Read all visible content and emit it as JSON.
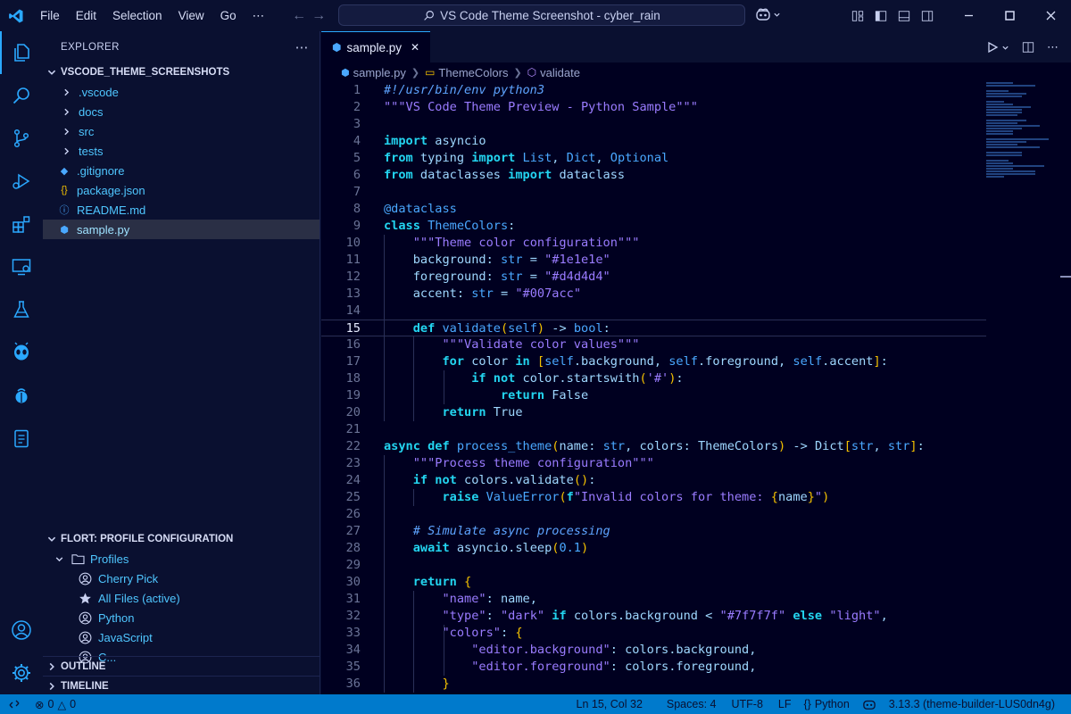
{
  "window": {
    "menu": [
      "File",
      "Edit",
      "Selection",
      "View",
      "Go",
      "⋯"
    ],
    "search_text": "VS Code Theme Screenshot - cyber_rain"
  },
  "sidebar": {
    "title": "EXPLORER",
    "more": "⋯",
    "workspace": "VSCODE_THEME_SCREENSHOTS",
    "items": [
      {
        "label": ".vscode",
        "kind": "folder"
      },
      {
        "label": "docs",
        "kind": "folder"
      },
      {
        "label": "src",
        "kind": "folder"
      },
      {
        "label": "tests",
        "kind": "folder"
      },
      {
        "label": ".gitignore",
        "kind": "file",
        "icon": "◆"
      },
      {
        "label": "package.json",
        "kind": "file",
        "icon": "{}"
      },
      {
        "label": "README.md",
        "kind": "file",
        "icon": "ⓘ"
      },
      {
        "label": "sample.py",
        "kind": "file",
        "icon": "⬢"
      }
    ],
    "profile_section": "FLORT: PROFILE CONFIGURATION",
    "profiles_label": "Profiles",
    "profiles": [
      "Cherry Pick",
      "All Files (active)",
      "Python",
      "JavaScript",
      "C..."
    ],
    "outline": "OUTLINE",
    "timeline": "TIMELINE"
  },
  "editor": {
    "tab": "sample.py",
    "close": "✕",
    "breadcrumb": [
      "sample.py",
      "ThemeColors",
      "validate"
    ],
    "current_line": 15,
    "lines": [
      [
        [
          "cm",
          "#!/usr/bin/env python3"
        ]
      ],
      [
        [
          "st",
          "\"\"\"VS Code Theme Preview - Python Sample\"\"\""
        ]
      ],
      [],
      [
        [
          "kw",
          "import"
        ],
        [
          "id",
          " asyncio"
        ]
      ],
      [
        [
          "kw",
          "from"
        ],
        [
          "id",
          " typing "
        ],
        [
          "kw",
          "import"
        ],
        [
          "ty",
          " List"
        ],
        [
          "op",
          ", "
        ],
        [
          "ty",
          "Dict"
        ],
        [
          "op",
          ", "
        ],
        [
          "ty",
          "Optional"
        ]
      ],
      [
        [
          "kw",
          "from"
        ],
        [
          "id",
          " dataclasses "
        ],
        [
          "kw",
          "import"
        ],
        [
          "id",
          " dataclass"
        ]
      ],
      [],
      [
        [
          "fn",
          "@dataclass"
        ]
      ],
      [
        [
          "kw",
          "class"
        ],
        [
          "ty",
          " ThemeColors"
        ],
        [
          "op",
          ":"
        ]
      ],
      [
        [
          "op",
          "    "
        ],
        [
          "st",
          "\"\"\"Theme color configuration\"\"\""
        ]
      ],
      [
        [
          "id",
          "    background"
        ],
        [
          "op",
          ": "
        ],
        [
          "ty",
          "str"
        ],
        [
          "op",
          " = "
        ],
        [
          "st",
          "\"#1e1e1e\""
        ]
      ],
      [
        [
          "id",
          "    foreground"
        ],
        [
          "op",
          ": "
        ],
        [
          "ty",
          "str"
        ],
        [
          "op",
          " = "
        ],
        [
          "st",
          "\"#d4d4d4\""
        ]
      ],
      [
        [
          "id",
          "    accent"
        ],
        [
          "op",
          ": "
        ],
        [
          "ty",
          "str"
        ],
        [
          "op",
          " = "
        ],
        [
          "st",
          "\"#007acc\""
        ]
      ],
      [],
      [
        [
          "op",
          "    "
        ],
        [
          "kw",
          "def"
        ],
        [
          "fn",
          " validate"
        ],
        [
          "br",
          "("
        ],
        [
          "ty",
          "self"
        ],
        [
          "br",
          ")"
        ],
        [
          "op",
          " -> "
        ],
        [
          "ty",
          "bool"
        ],
        [
          "op",
          ":"
        ]
      ],
      [
        [
          "op",
          "        "
        ],
        [
          "st",
          "\"\"\"Validate color values\"\"\""
        ]
      ],
      [
        [
          "op",
          "        "
        ],
        [
          "kw",
          "for"
        ],
        [
          "id",
          " color "
        ],
        [
          "kw",
          "in"
        ],
        [
          "op",
          " "
        ],
        [
          "br",
          "["
        ],
        [
          "ty",
          "self"
        ],
        [
          "id",
          ".background"
        ],
        [
          "op",
          ", "
        ],
        [
          "ty",
          "self"
        ],
        [
          "id",
          ".foreground"
        ],
        [
          "op",
          ", "
        ],
        [
          "ty",
          "self"
        ],
        [
          "id",
          ".accent"
        ],
        [
          "br",
          "]"
        ],
        [
          "op",
          ":"
        ]
      ],
      [
        [
          "op",
          "            "
        ],
        [
          "kw",
          "if not"
        ],
        [
          "id",
          " color.startswith"
        ],
        [
          "br",
          "("
        ],
        [
          "st",
          "'#'"
        ],
        [
          "br",
          ")"
        ],
        [
          "op",
          ":"
        ]
      ],
      [
        [
          "op",
          "                "
        ],
        [
          "kw",
          "return"
        ],
        [
          "id",
          " False"
        ]
      ],
      [
        [
          "op",
          "        "
        ],
        [
          "kw",
          "return"
        ],
        [
          "id",
          " True"
        ]
      ],
      [],
      [
        [
          "kw",
          "async def"
        ],
        [
          "fn",
          " process_theme"
        ],
        [
          "br",
          "("
        ],
        [
          "id",
          "name"
        ],
        [
          "op",
          ": "
        ],
        [
          "ty",
          "str"
        ],
        [
          "op",
          ", "
        ],
        [
          "id",
          "colors"
        ],
        [
          "op",
          ": "
        ],
        [
          "id",
          "ThemeColors"
        ],
        [
          "br",
          ")"
        ],
        [
          "op",
          " -> "
        ],
        [
          "id",
          "Dict"
        ],
        [
          "br",
          "["
        ],
        [
          "ty",
          "str"
        ],
        [
          "op",
          ", "
        ],
        [
          "ty",
          "str"
        ],
        [
          "br",
          "]"
        ],
        [
          "op",
          ":"
        ]
      ],
      [
        [
          "op",
          "    "
        ],
        [
          "st",
          "\"\"\"Process theme configuration\"\"\""
        ]
      ],
      [
        [
          "op",
          "    "
        ],
        [
          "kw",
          "if not"
        ],
        [
          "id",
          " colors.validate"
        ],
        [
          "br",
          "()"
        ],
        [
          "op",
          ":"
        ]
      ],
      [
        [
          "op",
          "        "
        ],
        [
          "kw",
          "raise"
        ],
        [
          "ty",
          " ValueError"
        ],
        [
          "br",
          "("
        ],
        [
          "kw",
          "f"
        ],
        [
          "st",
          "\"Invalid colors for theme: "
        ],
        [
          "br",
          "{"
        ],
        [
          "id",
          "name"
        ],
        [
          "br",
          "}"
        ],
        [
          "st",
          "\""
        ],
        [
          "br",
          ")"
        ]
      ],
      [],
      [
        [
          "op",
          "    "
        ],
        [
          "cm",
          "# Simulate async processing"
        ]
      ],
      [
        [
          "op",
          "    "
        ],
        [
          "kw",
          "await"
        ],
        [
          "id",
          " asyncio.sleep"
        ],
        [
          "br",
          "("
        ],
        [
          "nm",
          "0.1"
        ],
        [
          "br",
          ")"
        ]
      ],
      [],
      [
        [
          "op",
          "    "
        ],
        [
          "kw",
          "return"
        ],
        [
          "op",
          " "
        ],
        [
          "br",
          "{"
        ]
      ],
      [
        [
          "op",
          "        "
        ],
        [
          "st",
          "\"name\""
        ],
        [
          "op",
          ": "
        ],
        [
          "id",
          "name"
        ],
        [
          "op",
          ","
        ]
      ],
      [
        [
          "op",
          "        "
        ],
        [
          "st",
          "\"type\""
        ],
        [
          "op",
          ": "
        ],
        [
          "st",
          "\"dark\""
        ],
        [
          "op",
          " "
        ],
        [
          "kw",
          "if"
        ],
        [
          "id",
          " colors.background "
        ],
        [
          "op",
          "< "
        ],
        [
          "st",
          "\"#7f7f7f\""
        ],
        [
          "op",
          " "
        ],
        [
          "kw",
          "else"
        ],
        [
          "op",
          " "
        ],
        [
          "st",
          "\"light\""
        ],
        [
          "op",
          ","
        ]
      ],
      [
        [
          "op",
          "        "
        ],
        [
          "st",
          "\"colors\""
        ],
        [
          "op",
          ": "
        ],
        [
          "br",
          "{"
        ]
      ],
      [
        [
          "op",
          "            "
        ],
        [
          "st",
          "\"editor.background\""
        ],
        [
          "op",
          ": "
        ],
        [
          "id",
          "colors.background"
        ],
        [
          "op",
          ","
        ]
      ],
      [
        [
          "op",
          "            "
        ],
        [
          "st",
          "\"editor.foreground\""
        ],
        [
          "op",
          ": "
        ],
        [
          "id",
          "colors.foreground"
        ],
        [
          "op",
          ","
        ]
      ],
      [
        [
          "op",
          "        "
        ],
        [
          "br",
          "}"
        ]
      ]
    ]
  },
  "status": {
    "errors": "0",
    "warnings": "0",
    "position": "Ln 15, Col 32",
    "spaces": "Spaces: 4",
    "encoding": "UTF-8",
    "eol": "LF",
    "language": "Python",
    "interpreter": "3.13.3 (theme-builder-LUS0dn4g)"
  },
  "colors": {
    "accent": "#2aa8ff",
    "statusbar": "#007acc",
    "editor_bg": "#000020",
    "sidebar_bg": "#0a1030"
  }
}
